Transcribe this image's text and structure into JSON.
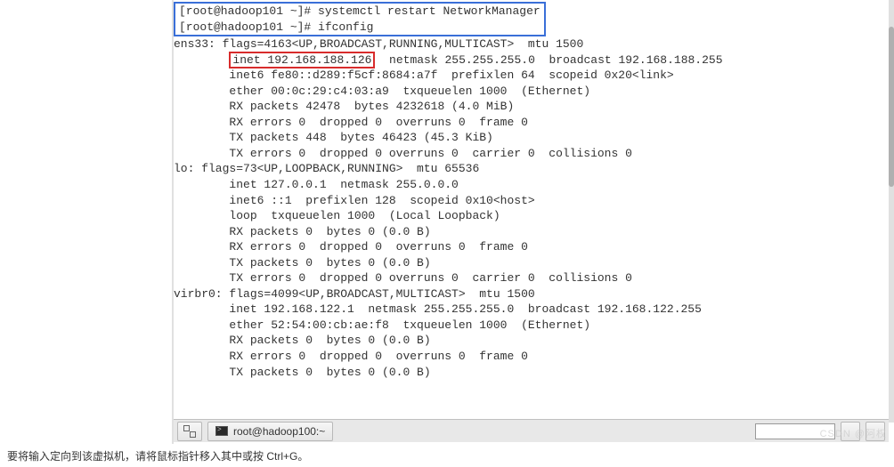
{
  "commands": {
    "prompt": "[root@hadoop101 ~]# ",
    "cmd1": "systemctl restart NetworkManager",
    "cmd2": "ifconfig"
  },
  "highlighted_inet": "inet 192.168.188.126",
  "output": {
    "l1": "ens33: flags=4163<UP,BROADCAST,RUNNING,MULTICAST>  mtu 1500",
    "l2_rest": "  netmask 255.255.255.0  broadcast 192.168.188.255",
    "l3": "        inet6 fe80::d289:f5cf:8684:a7f  prefixlen 64  scopeid 0x20<link>",
    "l4": "        ether 00:0c:29:c4:03:a9  txqueuelen 1000  (Ethernet)",
    "l5": "        RX packets 42478  bytes 4232618 (4.0 MiB)",
    "l6": "        RX errors 0  dropped 0  overruns 0  frame 0",
    "l7": "        TX packets 448  bytes 46423 (45.3 KiB)",
    "l8": "        TX errors 0  dropped 0 overruns 0  carrier 0  collisions 0",
    "b1": "",
    "l9": "lo: flags=73<UP,LOOPBACK,RUNNING>  mtu 65536",
    "l10": "        inet 127.0.0.1  netmask 255.0.0.0",
    "l11": "        inet6 ::1  prefixlen 128  scopeid 0x10<host>",
    "l12": "        loop  txqueuelen 1000  (Local Loopback)",
    "l13": "        RX packets 0  bytes 0 (0.0 B)",
    "l14": "        RX errors 0  dropped 0  overruns 0  frame 0",
    "l15": "        TX packets 0  bytes 0 (0.0 B)",
    "l16": "        TX errors 0  dropped 0 overruns 0  carrier 0  collisions 0",
    "b2": "",
    "l17": "virbr0: flags=4099<UP,BROADCAST,MULTICAST>  mtu 1500",
    "l18": "        inet 192.168.122.1  netmask 255.255.255.0  broadcast 192.168.122.255",
    "l19": "        ether 52:54:00:cb:ae:f8  txqueuelen 1000  (Ethernet)",
    "l20": "        RX packets 0  bytes 0 (0.0 B)",
    "l21": "        RX errors 0  dropped 0  overruns 0  frame 0",
    "l22": "        TX packets 0  bytes 0 (0.0 B)"
  },
  "taskbar": {
    "app_label": "root@hadoop100:~"
  },
  "watermark": "CSDN @阿权",
  "hint": "要将输入定向到该虚拟机，请将鼠标指针移入其中或按 Ctrl+G。"
}
